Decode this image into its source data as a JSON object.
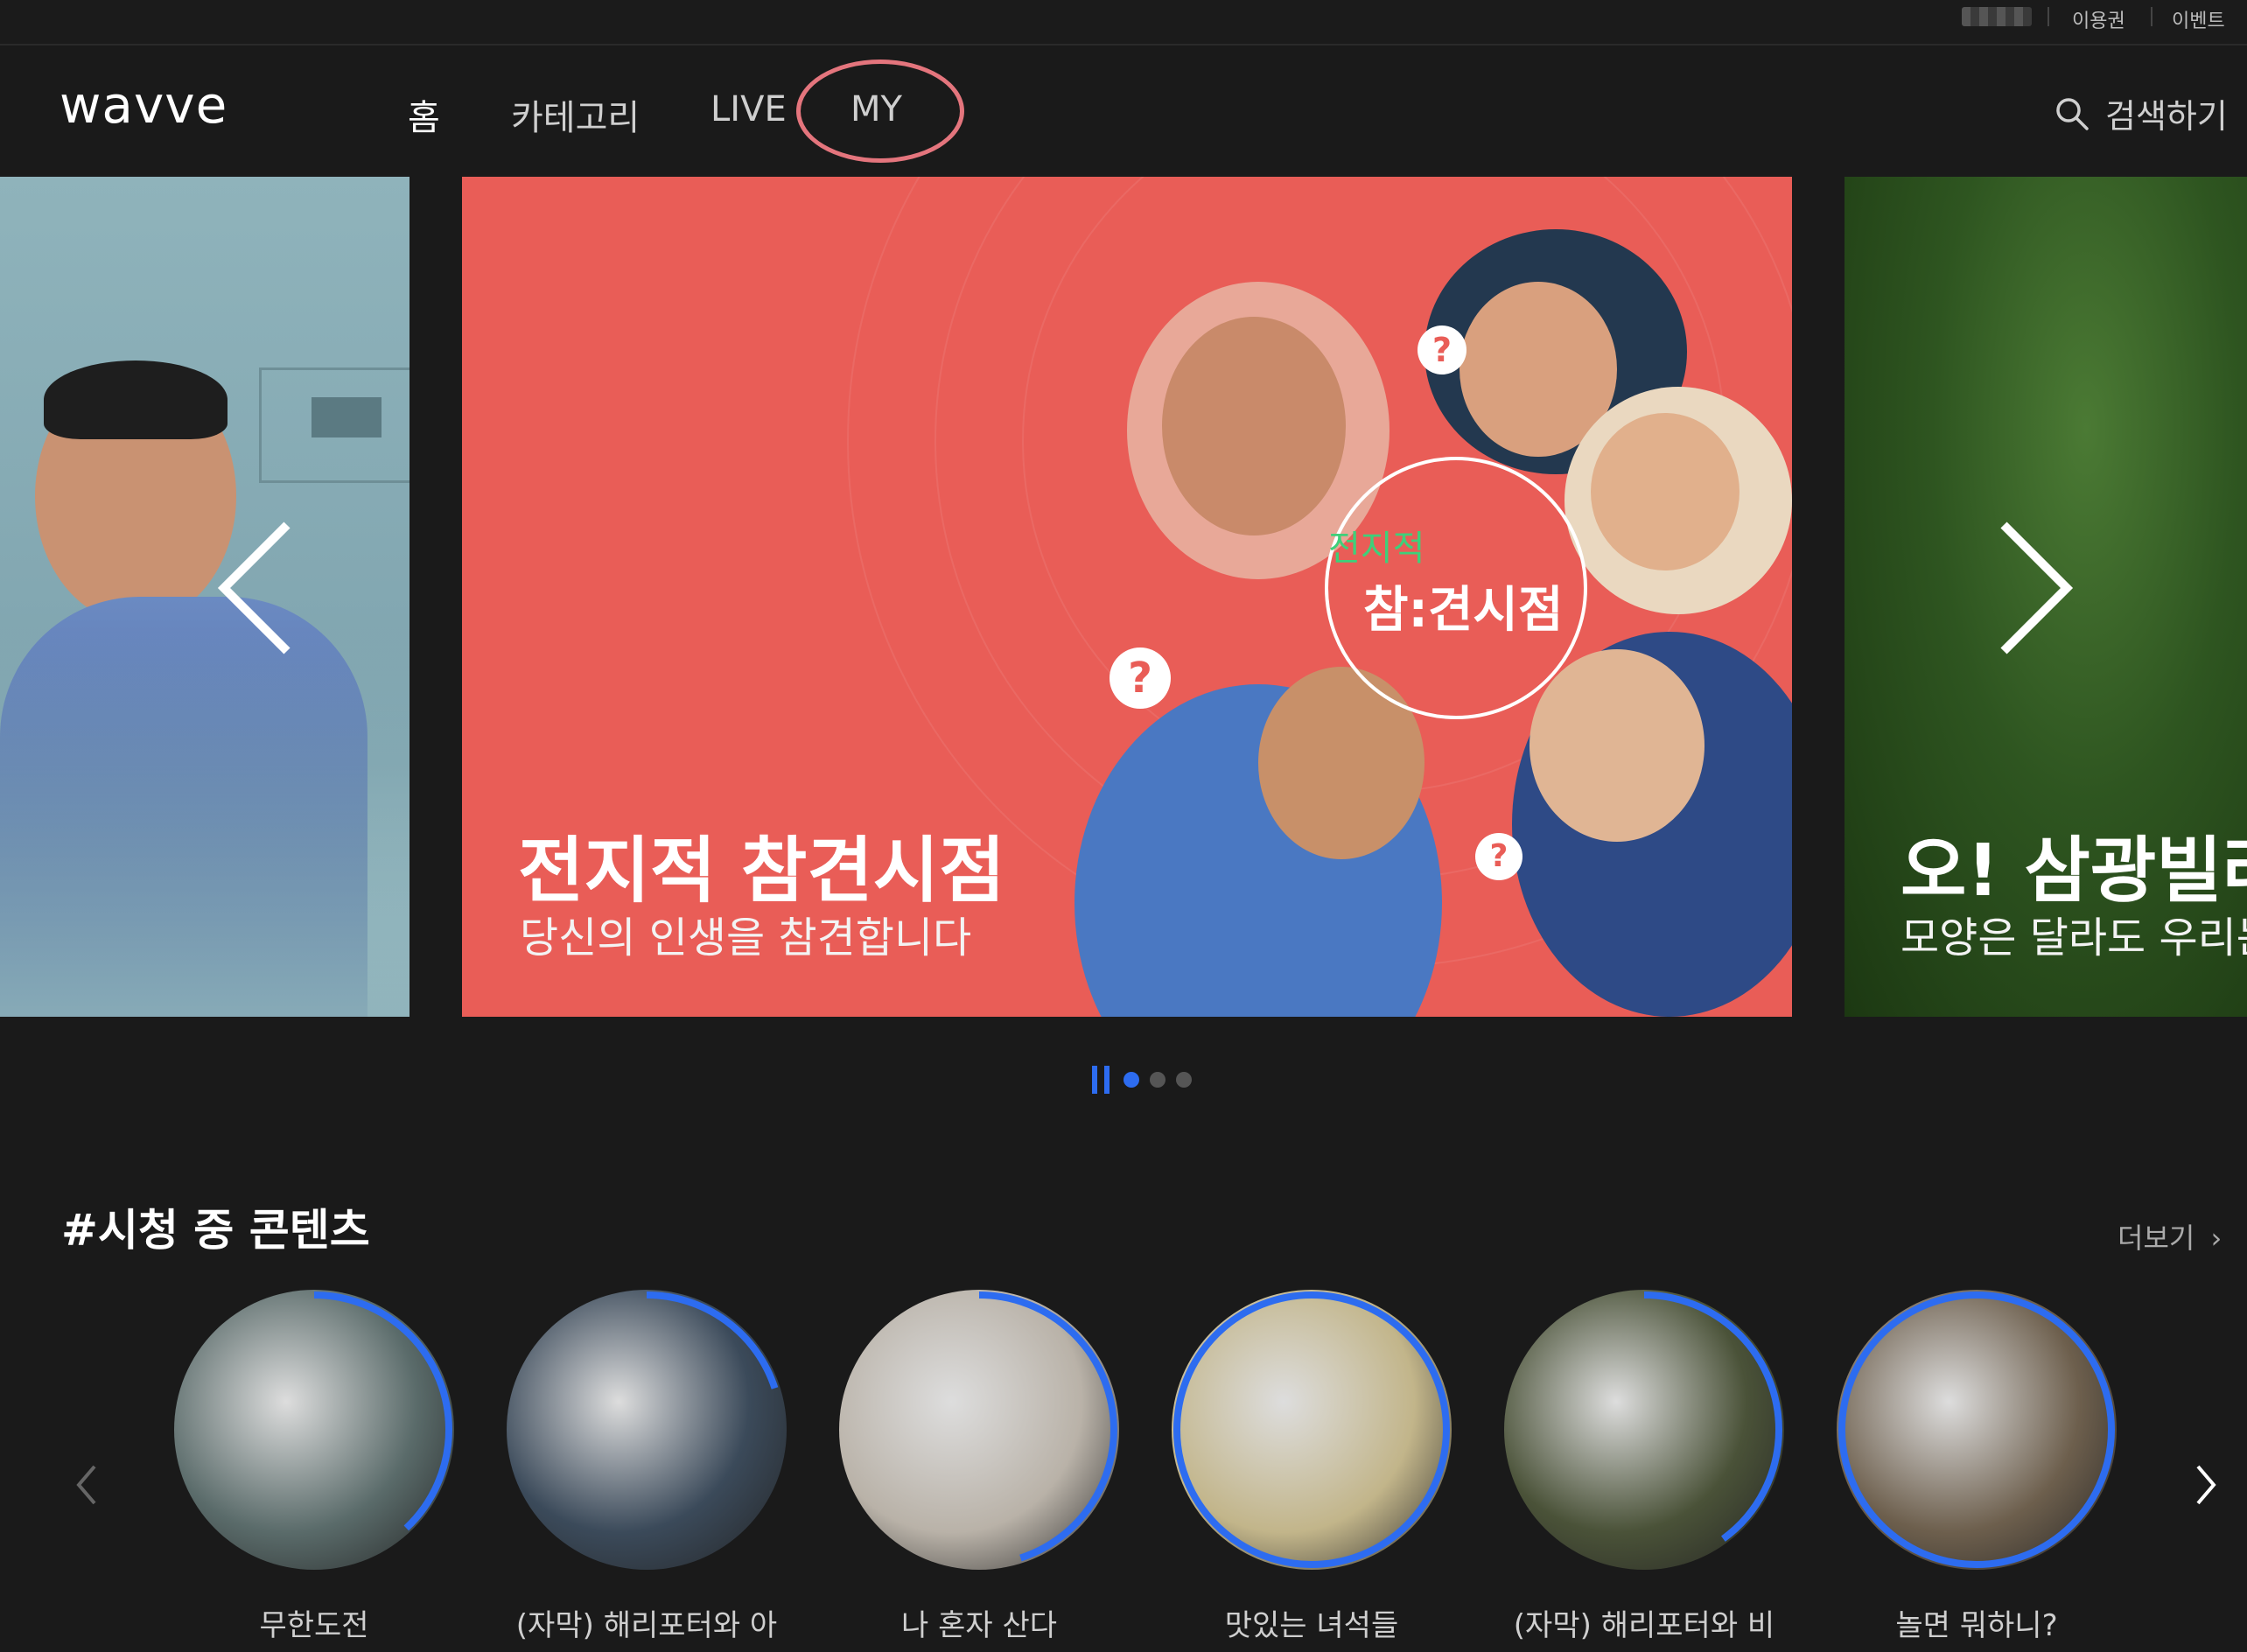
{
  "util": {
    "link1": "이용권",
    "link2": "이벤트"
  },
  "header": {
    "logo": "wavve",
    "nav": [
      "홈",
      "카테고리",
      "LIVE",
      "MY"
    ],
    "search_label": "검색하기"
  },
  "banners": [
    {
      "title": "전지적 참견시점",
      "subtitle": "당신의 인생을 참견합니다",
      "logo_top": "전지적",
      "logo_main": "참:견시점"
    },
    {
      "title": "오! 삼광빌라",
      "subtitle": "모양은 달라도 우리는"
    }
  ],
  "carousel": {
    "current_index": 0,
    "total": 3
  },
  "section": {
    "title": "#시청 중 콘텐츠",
    "more_label": "더보기",
    "items": [
      {
        "label": "무한도전",
        "progress": 0.38,
        "color": "#5a6b6a"
      },
      {
        "label": "(자막) 해리포터와 아",
        "progress": 0.2,
        "color": "#3b4a5a"
      },
      {
        "label": "나 혼자 산다",
        "progress": 0.45,
        "color": "#b9b2a8"
      },
      {
        "label": "맛있는 녀석들",
        "progress": 1.0,
        "color": "#c2b58a"
      },
      {
        "label": "(자막) 해리포터와 비",
        "progress": 0.4,
        "color": "#4a5238"
      },
      {
        "label": "놀면 뭐하니?",
        "progress": 1.0,
        "color": "#6d5f4d"
      }
    ]
  },
  "colors": {
    "accent": "#2d6cf0",
    "banner_bg": "#e95d57",
    "highlight_ring": "#e4757d"
  }
}
